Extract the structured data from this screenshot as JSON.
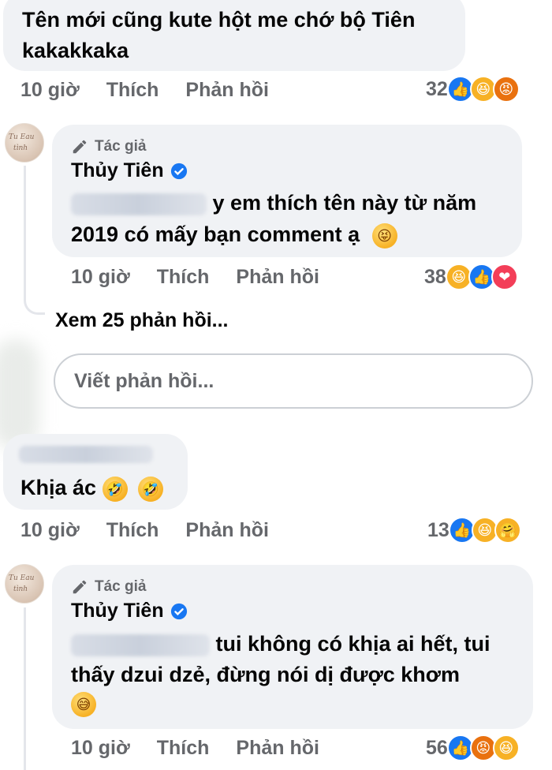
{
  "comment1": {
    "line1": "Tên mới cũng kute hột me chớ bộ Tiên",
    "line2": "kakakkaka",
    "time": "10 giờ",
    "like_label": "Thích",
    "reply_label": "Phản hồi",
    "reaction_count": "32",
    "reactions": [
      "like-icon",
      "haha-icon",
      "angry-icon"
    ]
  },
  "reply1": {
    "author_tag": "Tác giả",
    "name": "Thủy Tiên",
    "line1_visible": "y em thích tên này từ năm",
    "line2": "2019 có mấy bạn comment ạ",
    "emoji": "squinting-tongue-emoji",
    "time": "10 giờ",
    "like_label": "Thích",
    "reply_label": "Phản hồi",
    "reaction_count": "38",
    "reactions": [
      "haha-icon",
      "like-icon",
      "love-icon"
    ]
  },
  "view_replies": "Xem 25 phản hồi...",
  "reply_input": {
    "placeholder": "Viết phản hồi..."
  },
  "comment2": {
    "text": "Khịa ác",
    "emojis": [
      "rolling-laughing-emoji",
      "rolling-laughing-emoji"
    ],
    "time": "10 giờ",
    "like_label": "Thích",
    "reply_label": "Phản hồi",
    "reaction_count": "13",
    "reactions": [
      "like-icon",
      "haha-icon",
      "care-icon"
    ]
  },
  "reply2": {
    "author_tag": "Tác giả",
    "name": "Thủy Tiên",
    "line1_visible": "tui không có khịa ai hết, tui",
    "line2": "thấy dzui dzẻ, đừng nói dị được khơm",
    "emoji": "sweat-smile-emoji",
    "time": "10 giờ",
    "like_label": "Thích",
    "reply_label": "Phản hồi",
    "reaction_count": "56",
    "reactions": [
      "like-icon",
      "angry-icon",
      "haha-icon"
    ]
  },
  "colors": {
    "bubble": "#f0f2f5",
    "meta_text": "#65676b",
    "like_blue": "#1877f2",
    "haha_yellow": "#f7b125",
    "angry_orange": "#e9710f",
    "love_red": "#f33e58"
  }
}
